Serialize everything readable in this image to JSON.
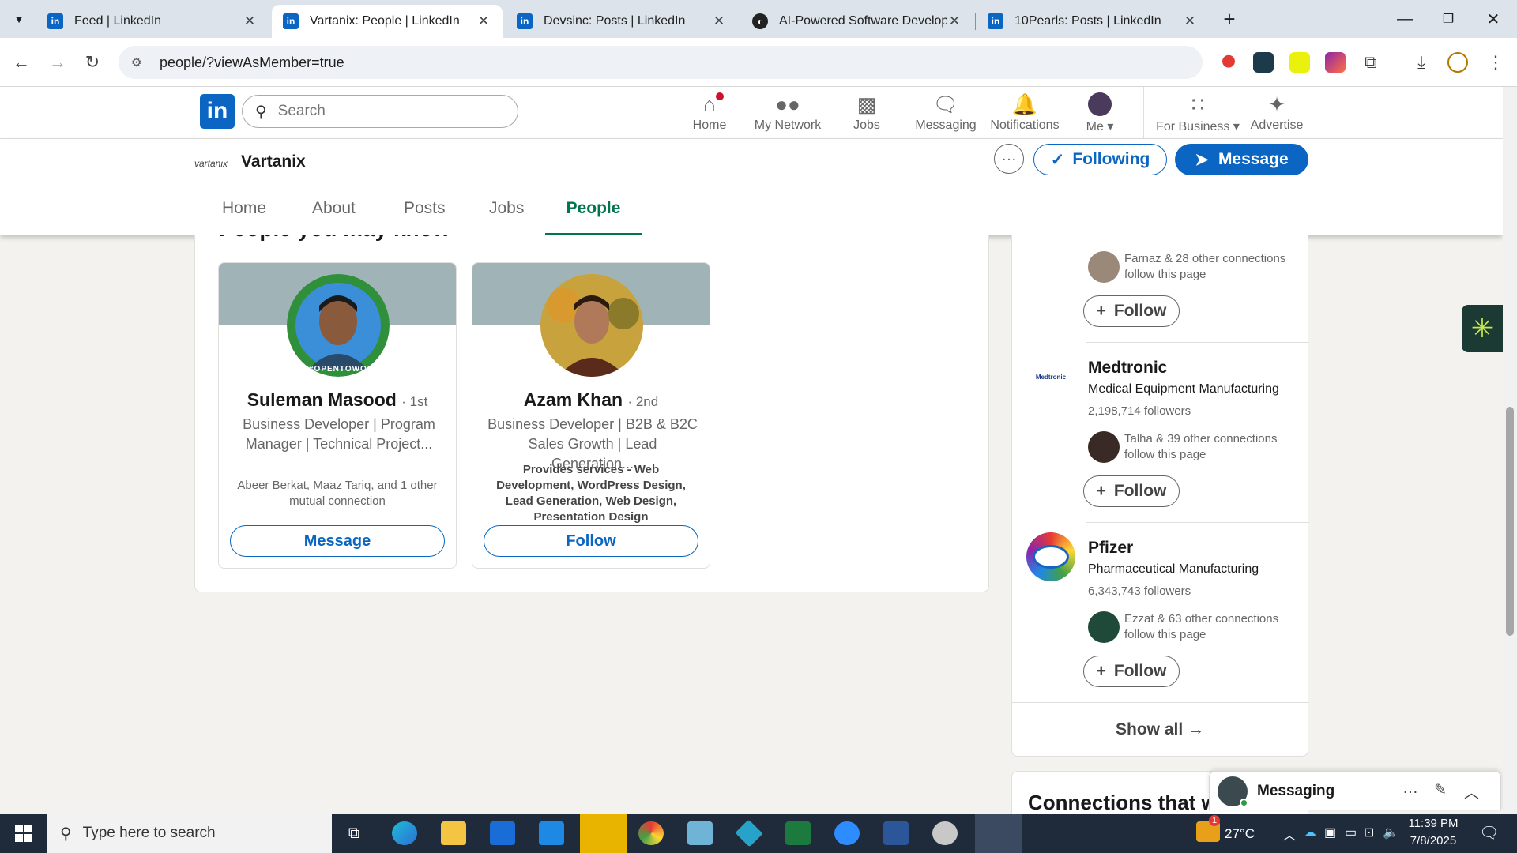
{
  "browser": {
    "tabs": [
      {
        "title": "Feed | LinkedIn",
        "icon": "linkedin-icon"
      },
      {
        "title": "Vartanix: People | LinkedIn",
        "icon": "linkedin-icon",
        "active": true
      },
      {
        "title": "Devsinc: Posts | LinkedIn",
        "icon": "linkedin-icon"
      },
      {
        "title": "AI-Powered Software Developm",
        "icon": "site-icon"
      },
      {
        "title": "10Pearls: Posts | LinkedIn",
        "icon": "linkedin-icon"
      }
    ],
    "url": "people/?viewAsMember=true"
  },
  "linkedin": {
    "search_placeholder": "Search",
    "nav": [
      {
        "label": "Home",
        "icon": "home-icon",
        "badge": true
      },
      {
        "label": "My Network",
        "icon": "network-icon"
      },
      {
        "label": "Jobs",
        "icon": "briefcase-icon"
      },
      {
        "label": "Messaging",
        "icon": "chat-icon"
      },
      {
        "label": "Notifications",
        "icon": "bell-icon"
      },
      {
        "label": "Me",
        "icon": "avatar"
      },
      {
        "label": "For Business",
        "icon": "grid-icon"
      },
      {
        "label": "Advertise",
        "icon": "compass-icon"
      }
    ]
  },
  "company": {
    "logo_text": "vartanix",
    "name": "Vartanix",
    "following_label": "Following",
    "message_label": "Message",
    "tabs": [
      "Home",
      "About",
      "Posts",
      "Jobs",
      "People"
    ],
    "active_tab": "People"
  },
  "pymk": {
    "heading": "People you may know",
    "people": [
      {
        "name": "Suleman Masood",
        "degree": "· 1st",
        "headline": "Business Developer | Program Manager | Technical Project...",
        "detail": "Abeer Berkat, Maaz Tariq, and 1 other mutual connection",
        "button": "Message",
        "avatar_ring": "#OPENTOWORK"
      },
      {
        "name": "Azam Khan",
        "degree": "· 2nd",
        "headline": "Business Developer | B2B & B2C Sales Growth | Lead Generation...",
        "services": "Provides services - Web Development, WordPress Design, Lead Generation, Web Design, Presentation Design",
        "button": "Follow"
      }
    ]
  },
  "rail": {
    "items": [
      {
        "connections": "Farnaz & 28 other connections follow this page",
        "button": "Follow"
      },
      {
        "name": "Medtronic",
        "industry": "Medical Equipment Manufacturing",
        "followers": "2,198,714 followers",
        "logo_text": "Medtronic",
        "connections": "Talha & 39 other connections follow this page",
        "button": "Follow"
      },
      {
        "name": "Pfizer",
        "industry": "Pharmaceutical Manufacturing",
        "followers": "6,343,743 followers",
        "connections": "Ezzat & 63 other connections follow this page",
        "button": "Follow"
      }
    ],
    "show_all": "Show all →",
    "next_card_title": "Connections that wo"
  },
  "messaging": {
    "title": "Messaging"
  },
  "taskbar": {
    "search_placeholder": "Type here to search",
    "weather": "27°C",
    "time": "11:39 PM",
    "date": "7/8/2025",
    "weather_badge": "1"
  },
  "colors": {
    "linkedin_blue": "#0a66c2",
    "active_tab_green": "#01754f"
  }
}
